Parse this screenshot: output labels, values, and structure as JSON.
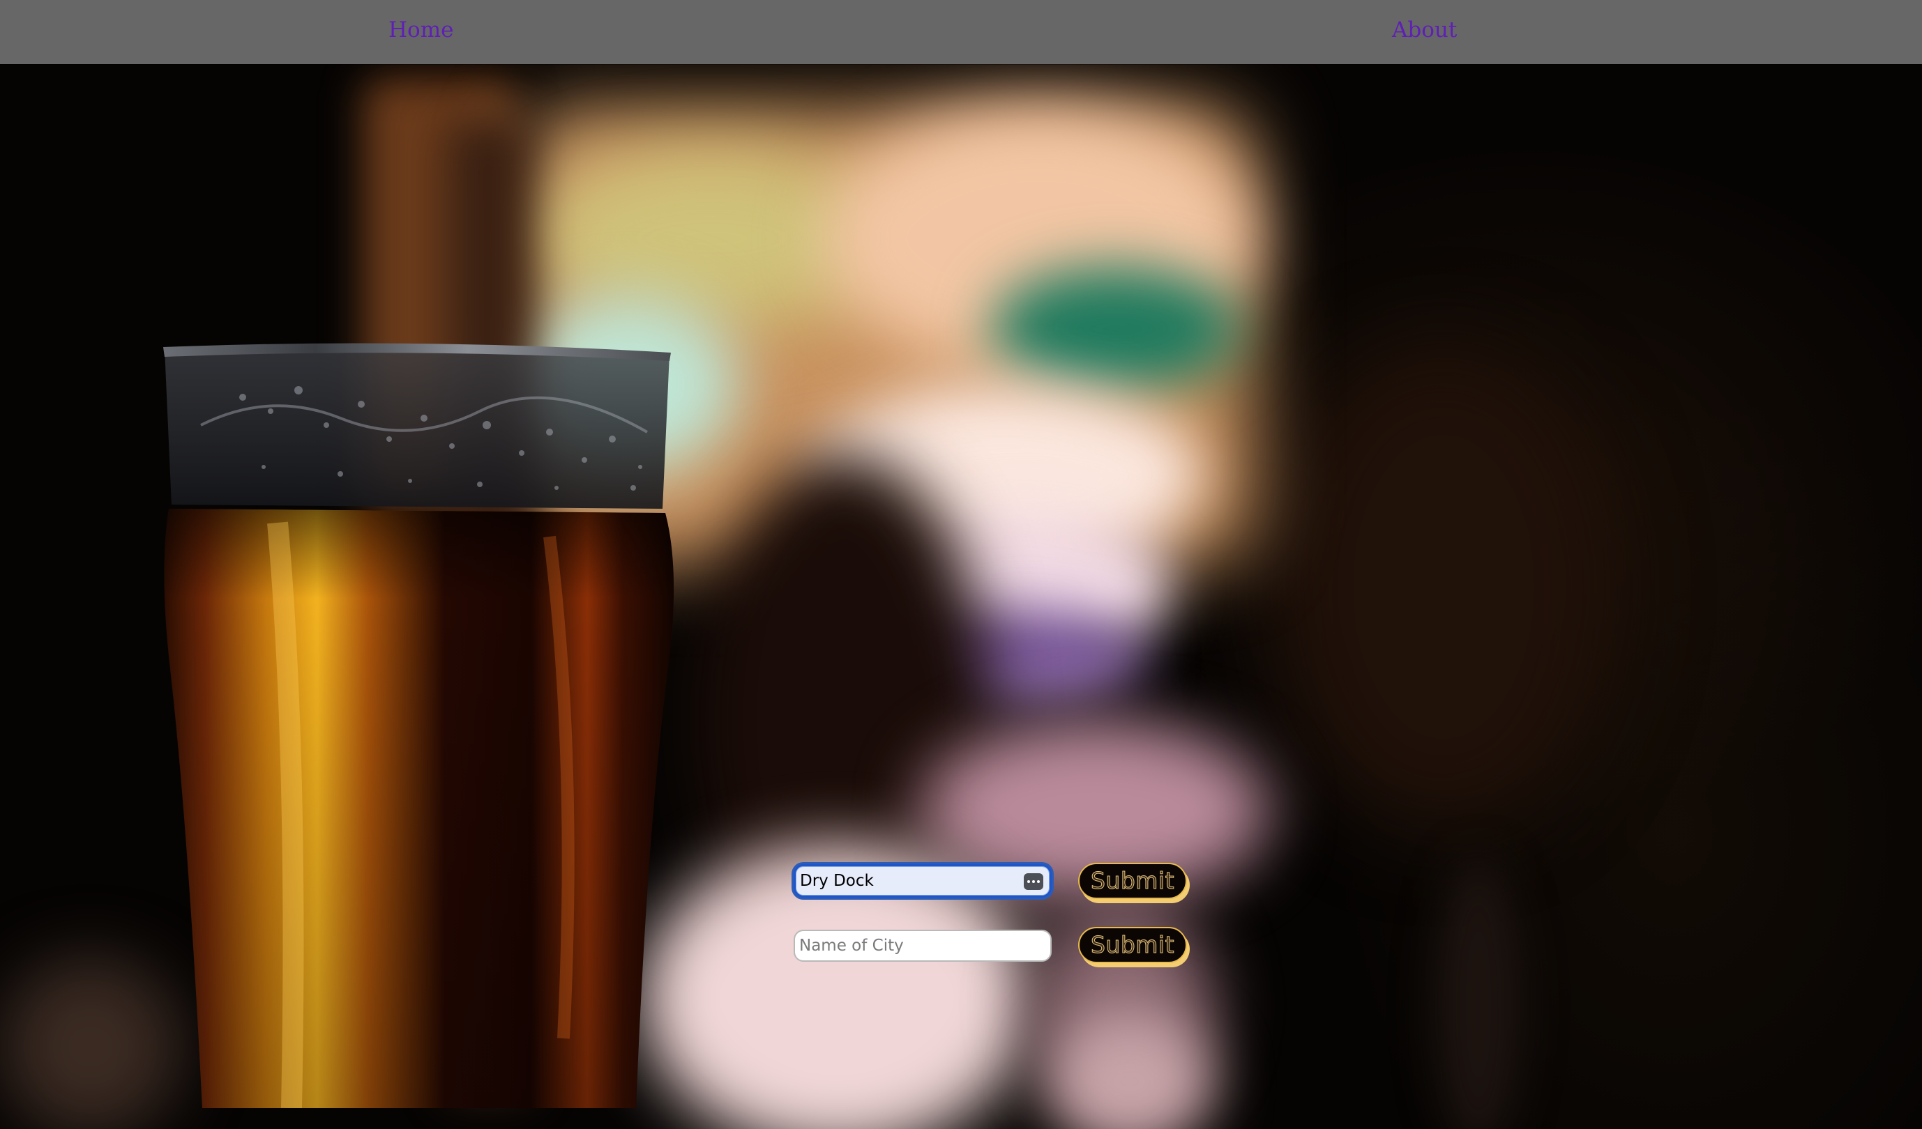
{
  "nav": {
    "home_label": "Home",
    "about_label": "About",
    "link_color": "#5f1fb7",
    "bar_color": "#676767"
  },
  "background": {
    "description_icon": "blurred-bar-photo-with-pint-glass"
  },
  "forms": [
    {
      "input_value": "Dry Dock",
      "input_placeholder": "",
      "focused": true,
      "autofill_icon": "autofill-key-icon",
      "submit_label": "Submit"
    },
    {
      "input_value": "",
      "input_placeholder": "Name of City",
      "focused": false,
      "submit_label": "Submit"
    }
  ],
  "colors": {
    "focus_ring": "#1e56c7",
    "button_border": "#e9b94a",
    "button_shadow": "#f4cd72"
  }
}
